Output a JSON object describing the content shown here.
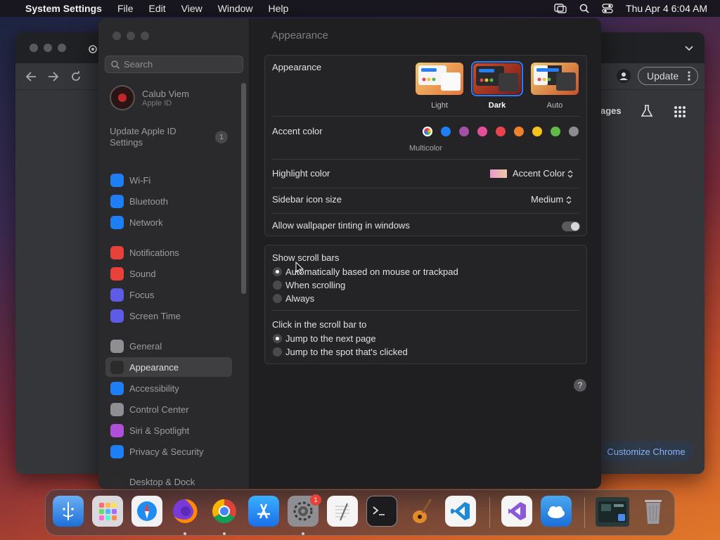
{
  "menubar": {
    "app": "System Settings",
    "items": [
      "File",
      "Edit",
      "View",
      "Window",
      "Help"
    ],
    "clock": "Thu Apr 4  6:04 AM"
  },
  "chrome": {
    "update_label": "Update",
    "nav_label": "ages",
    "customize_label": "Customize Chrome"
  },
  "sidebar": {
    "search_placeholder": "Search",
    "account_name": "Calub Viem",
    "account_sub": "Apple ID",
    "update_label": "Update Apple ID Settings",
    "update_badge": "1",
    "items": [
      {
        "label": "Wi-Fi",
        "color": "#1e7ef3"
      },
      {
        "label": "Bluetooth",
        "color": "#1e7ef3"
      },
      {
        "label": "Network",
        "color": "#1e7ef3"
      },
      {
        "label": "Notifications",
        "color": "#e8413a"
      },
      {
        "label": "Sound",
        "color": "#e8413a"
      },
      {
        "label": "Focus",
        "color": "#5e5ce6"
      },
      {
        "label": "Screen Time",
        "color": "#5e5ce6"
      },
      {
        "label": "General",
        "color": "#8e8e93"
      },
      {
        "label": "Appearance",
        "color": "#2b2b2b"
      },
      {
        "label": "Accessibility",
        "color": "#1e7ef3"
      },
      {
        "label": "Control Center",
        "color": "#8e8e93"
      },
      {
        "label": "Siri & Spotlight",
        "color": "#b04fd9"
      },
      {
        "label": "Privacy & Security",
        "color": "#1e7ef3"
      },
      {
        "label": "Desktop & Dock",
        "color": "#2b2b2b"
      }
    ]
  },
  "main": {
    "page_title": "Appearance",
    "appearance": {
      "label": "Appearance",
      "options": [
        {
          "label": "Light"
        },
        {
          "label": "Dark"
        },
        {
          "label": "Auto"
        }
      ],
      "selected": "Dark"
    },
    "accent": {
      "label": "Accent color",
      "selected_label": "Multicolor",
      "colors": [
        "#b96ef6",
        "#1e7ef3",
        "#a550a7",
        "#e54e9b",
        "#e9444e",
        "#f0812c",
        "#f5c31b",
        "#61b947",
        "#8c8c8c"
      ]
    },
    "highlight": {
      "label": "Highlight color",
      "value": "Accent Color"
    },
    "icon_size": {
      "label": "Sidebar icon size",
      "value": "Medium"
    },
    "tinting": {
      "label": "Allow wallpaper tinting in windows",
      "on": true
    },
    "scrollbars": {
      "label": "Show scroll bars",
      "options": [
        "Automatically based on mouse or trackpad",
        "When scrolling",
        "Always"
      ],
      "selected": 0
    },
    "click": {
      "label": "Click in the scroll bar to",
      "options": [
        "Jump to the next page",
        "Jump to the spot that's clicked"
      ],
      "selected": 0
    },
    "help": "?"
  },
  "dock": {
    "apps": [
      "finder",
      "launchpad",
      "safari",
      "firefox",
      "chrome",
      "app-store",
      "system-settings",
      "textedit",
      "terminal",
      "garageband",
      "vscode",
      "visual-studio",
      "weather",
      "window-preview",
      "trash"
    ],
    "settings_badge": "1"
  }
}
